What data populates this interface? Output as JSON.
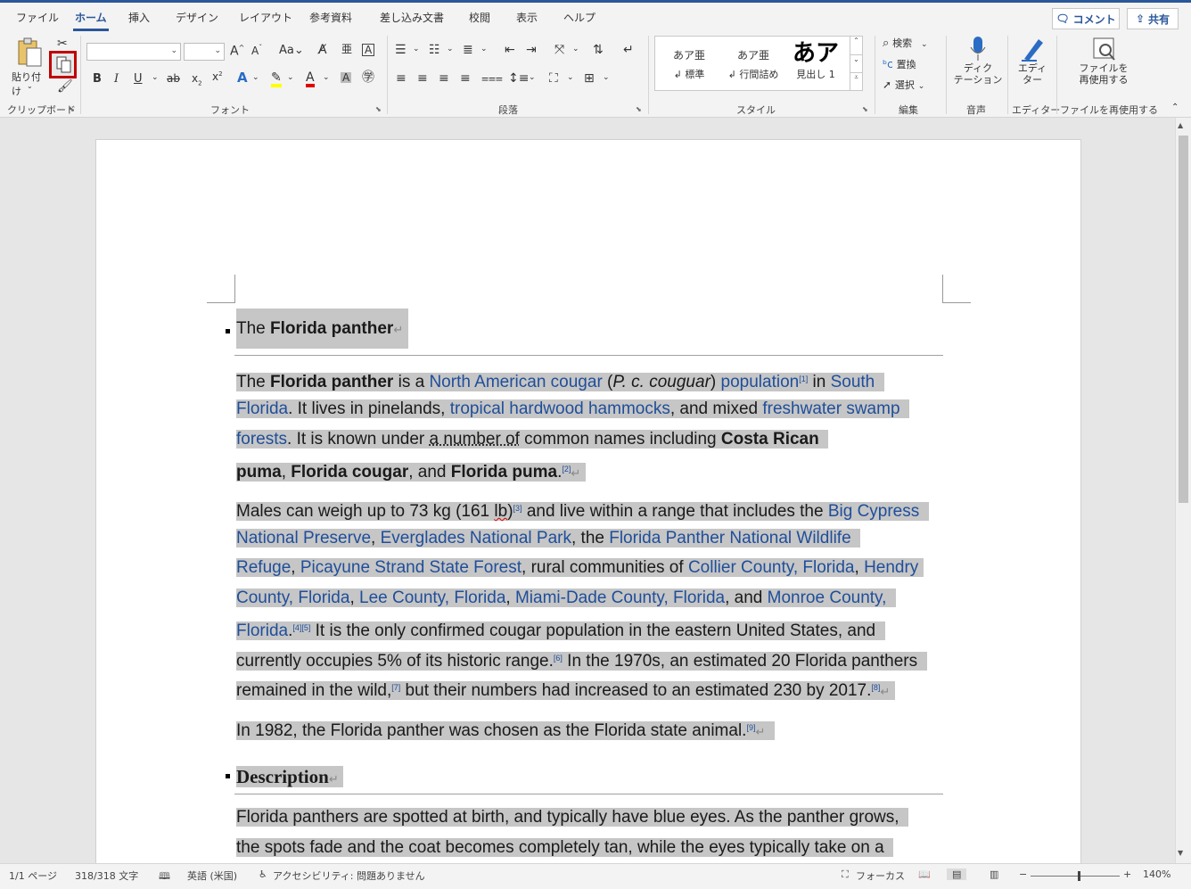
{
  "tabs": [
    "ファイル",
    "ホーム",
    "挿入",
    "デザイン",
    "レイアウト",
    "参考資料",
    "差し込み文書",
    "校閲",
    "表示",
    "ヘルプ"
  ],
  "active_tab": "ホーム",
  "top_buttons": {
    "comment": "コメント",
    "share": "共有"
  },
  "ribbon": {
    "clipboard": {
      "paste_label": "貼り付け",
      "group_label": "クリップボード"
    },
    "font": {
      "group_label": "フォント",
      "font_name": "",
      "font_size": "",
      "case_label": "Aa"
    },
    "paragraph": {
      "group_label": "段落"
    },
    "styles": {
      "group_label": "スタイル",
      "items": [
        {
          "preview": "あア亜",
          "name": "↲ 標準"
        },
        {
          "preview": "あア亜",
          "name": "↲ 行間詰め"
        },
        {
          "preview": "あア",
          "name": "見出し 1"
        }
      ]
    },
    "editing": {
      "group_label": "編集",
      "find": "検索",
      "replace": "置換",
      "select": "選択"
    },
    "voice": {
      "group_label": "音声",
      "dictate": "ディク\nテーション",
      "dictate_l1": "ディク",
      "dictate_l2": "テーション"
    },
    "editor": {
      "group_label": "エディター",
      "editor_l1": "エディ",
      "editor_l2": "ター"
    },
    "reuse": {
      "group_label": "ファイルを再使用する",
      "reuse_l1": "ファイルを",
      "reuse_l2": "再使用する"
    }
  },
  "document": {
    "h1_pre": "The ",
    "h1_bold": "Florida panther",
    "p1": {
      "l1": [
        "The ",
        "Florida panther",
        " is a ",
        "North American cougar",
        " (",
        "P. c. couguar",
        ") ",
        "population",
        "[1]",
        " in ",
        "South"
      ],
      "l2": [
        "Florida",
        ". It lives in pinelands, ",
        "tropical hardwood hammocks",
        ", and mixed ",
        "freshwater swamp"
      ],
      "l3": [
        "forests",
        ". It is known under ",
        "a number of",
        " common names including ",
        "Costa Rican"
      ],
      "l4": [
        "puma",
        ", ",
        "Florida cougar",
        ", and ",
        "Florida puma",
        ".",
        "[2]"
      ]
    },
    "p2": {
      "l1": [
        "Males can weigh up to 73 kg (161 ",
        "lb",
        ")",
        "[3]",
        " and live within a range that includes the ",
        "Big Cypress"
      ],
      "l2": [
        "National Preserve",
        ", ",
        "Everglades National Park",
        ", the ",
        "Florida Panther National Wildlife"
      ],
      "l3": [
        "Refuge",
        ", ",
        "Picayune Strand State Forest",
        ", rural communities of ",
        "Collier County, Florida",
        ", ",
        "Hendry"
      ],
      "l4": [
        "County, Florida",
        ", ",
        "Lee County, Florida",
        ", ",
        "Miami-Dade County, Florida",
        ", and ",
        "Monroe County,"
      ],
      "l5": [
        "Florida",
        ".",
        "[4][5]",
        " It is the only confirmed cougar population in the eastern United States, and"
      ],
      "l6": [
        "currently occupies 5% of its historic range.",
        "[6]",
        " In the 1970s, an estimated 20 Florida panthers"
      ],
      "l7": [
        "remained in the wild,",
        "[7]",
        " but their numbers had increased to an estimated 230 by 2017.",
        "[8]"
      ]
    },
    "p3": [
      "In 1982, the Florida panther was chosen as the Florida state animal.",
      "[9]"
    ],
    "h2": "Description",
    "p4": {
      "l1": "Florida panthers are spotted at birth, and typically have blue eyes. As the panther grows,",
      "l2": "the spots fade and the coat becomes completely tan, while the eyes typically take on a"
    },
    "para_mark": "↵"
  },
  "status": {
    "page": "1/1 ページ",
    "words": "318/318 文字",
    "language": "英語 (米国)",
    "accessibility": "アクセシビリティ: 問題ありません",
    "focus": "フォーカス",
    "zoom": "140%"
  }
}
